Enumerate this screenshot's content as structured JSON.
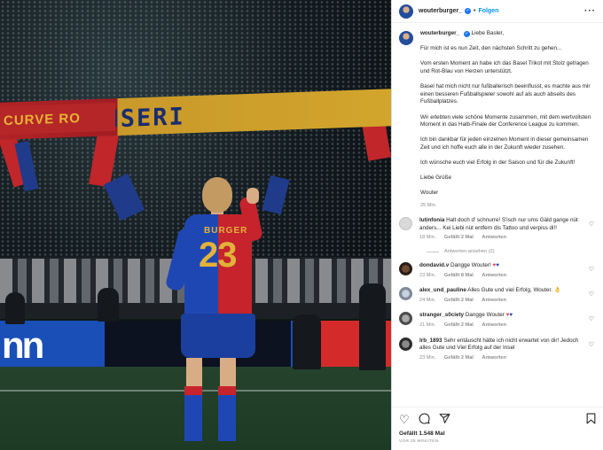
{
  "colors": {
    "accent": "#0095f6",
    "verified": "#1a77f2",
    "text": "#262626",
    "muted": "#8e8e8e",
    "heart": "#ed4956"
  },
  "photo": {
    "banner_text": "ISCH UNSERI",
    "banner_left_text": "CURVE RO",
    "ad_text": "nn",
    "player_name": "BURGER",
    "player_number": "23"
  },
  "header": {
    "username": "wouterburger_",
    "follow_label": "Folgen",
    "more_icon": "more-horizontal-icon"
  },
  "caption": {
    "username": "wouterburger_",
    "greeting": "Liebe Basler,",
    "paragraphs": [
      "Für mich ist es nun Zeit, den nächsten Schritt zu gehen...",
      "Vom ersten Moment an habe ich das Basel Trikot mit Stolz getragen und Rot-Blau von Herzen unterstützt.",
      "Basel hat mich nicht nur fußballerisch beeinflusst, es machte aus mir einen besseren Fußballspieler sowohl auf als auch abseits des Fußballplatzes.",
      "Wir erlebten viele schöne Momente zusammen, mit dem wertvollsten Moment in das Halb-Finale der Conference League zu kommen.",
      "Ich bin dankbar für jeden einzelnen Moment in dieser gemeinsamen Zeit und ich hoffe euch alle in der Zukunft wieder zusehen.",
      "Ich wünsche euch viel Erfolg in der Saison und für die Zukunft!",
      "Liebe Grüße",
      "Wouter"
    ],
    "time": "25 Min."
  },
  "comments": [
    {
      "user": "lutinfonia",
      "text": "Halt doch d' schnurre! S'isch nur ums Gäld gange nüt anders... Kei Liebi nüt entfern dis Tattoo und verpiss di!!",
      "time": "18 Min.",
      "likes": "Gefällt 2 Mal",
      "reply": "Antworten",
      "avatar_color": "#d9d9d9",
      "view_replies": "Antworten ansehen (2)"
    },
    {
      "user": "dondavid.v",
      "text": "Dangge Wouter!",
      "emoji": "♥♥",
      "time": "23 Min.",
      "likes": "Gefällt 8 Mal",
      "reply": "Antworten",
      "avatar_color": "#3b2a1e"
    },
    {
      "user": "alex_und_pauline",
      "text": "Alles Gute und viel Erfolg, Wouter.",
      "emoji": "👌",
      "time": "24 Min.",
      "likes": "Gefällt 2 Mal",
      "reply": "Antworten",
      "avatar_color": "#7e8a99"
    },
    {
      "user": "stranger_s0ciety",
      "text": "Dangge Wouter",
      "emoji": "♥♥",
      "time": "21 Min.",
      "likes": "Gefällt 2 Mal",
      "reply": "Antworten",
      "avatar_color": "#6d6d6d"
    },
    {
      "user": "lrb_1893",
      "text": "Sehr entäuscht hätte ich nicht erwartet von dir! Jedoch alles Gute und Viel Erfolg auf der Insel",
      "time": "23 Min.",
      "likes": "Gefällt 2 Mal",
      "reply": "Antworten",
      "avatar_color": "#3a3a3a"
    }
  ],
  "actions": {
    "like_icon": "heart-outline-icon",
    "comment_icon": "comment-icon",
    "share_icon": "paper-plane-icon",
    "save_icon": "bookmark-icon",
    "likes_text": "Gefällt 1.548 Mal",
    "posted_text": "VOR 25 MINUTEN"
  }
}
